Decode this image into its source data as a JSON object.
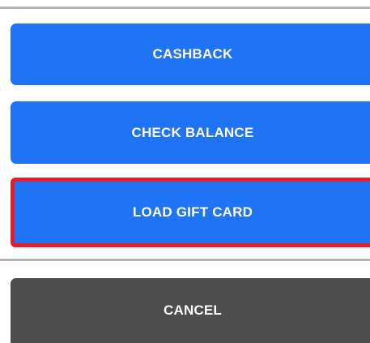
{
  "buttons": {
    "cashback_label": "CASHBACK",
    "check_balance_label": "CHECK BALANCE",
    "load_gift_card_label": "LOAD GIFT CARD",
    "cancel_label": "CANCEL"
  },
  "colors": {
    "primary": "#1f73f5",
    "secondary": "#4d4d4d",
    "highlight": "#e51e2a",
    "divider": "#b3b3b3"
  }
}
